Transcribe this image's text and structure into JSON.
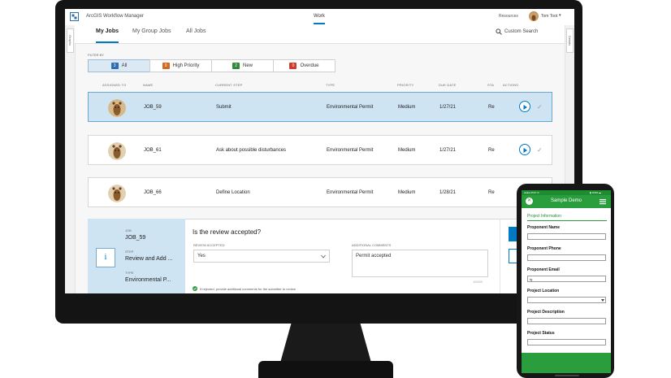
{
  "app": {
    "title": "ArcGIS Workflow Manager",
    "nav_work": "Work",
    "resources": "Resources",
    "user_name": "Tom Toot",
    "user_caret": "▾"
  },
  "rails": {
    "left": "Graphs",
    "right": "Details"
  },
  "tabs": [
    "My Jobs",
    "My Group Jobs",
    "All Jobs"
  ],
  "search": {
    "label": "Custom Search"
  },
  "filter": {
    "label": "FILTER BY",
    "chips": [
      {
        "count": "3",
        "label": "All",
        "color": "#2f6fb1"
      },
      {
        "count": "0",
        "label": "High Priority",
        "color": "#d2691e"
      },
      {
        "count": "2",
        "label": "New",
        "color": "#2e8b3a"
      },
      {
        "count": "0",
        "label": "Overdue",
        "color": "#d03a2a"
      }
    ]
  },
  "table": {
    "headers": [
      "ASSIGNED TO",
      "NAME",
      "CURRENT STEP",
      "TYPE",
      "PRIORITY",
      "DUE DATE",
      "STA",
      "ACTIONS"
    ],
    "rows": [
      {
        "name": "JOB_59",
        "step": "Submit",
        "type": "Environmental Permit",
        "priority": "Medium",
        "due": "1/27/21",
        "status": "Re"
      },
      {
        "name": "JOB_61",
        "step": "Ask about possible disturbances",
        "type": "Environmental Permit",
        "priority": "Medium",
        "due": "1/27/21",
        "status": "Re"
      },
      {
        "name": "JOB_66",
        "step": "Define Location",
        "type": "Environmental Permit",
        "priority": "Medium",
        "due": "1/28/21",
        "status": "Re"
      }
    ]
  },
  "detail": {
    "job_label": "JOB",
    "job_value": "JOB_59",
    "step_label": "STEP",
    "step_value": "Review and Add ...",
    "type_label": "TYPE",
    "type_value": "Environmental P...",
    "info_icon": "i",
    "question": "Is the review accepted?",
    "review_label": "REVIEW ACCEPTED",
    "review_value": "Yes",
    "comments_label": "ADDITIONAL COMMENTS",
    "comments_value": "Permit accepted",
    "char_count": "15/500",
    "hint": "If rejected, provide additional comments for the submitter to review"
  },
  "phone": {
    "status_left": "●●●● AT&T ≋",
    "status_right": "▮ 100% ▬",
    "title": "Sample Demo",
    "section": "Project Information",
    "fields": [
      {
        "label": "Proponent Name",
        "value": ""
      },
      {
        "label": "Proponent Phone",
        "value": ""
      },
      {
        "label": "Proponent Email",
        "value": "tg"
      },
      {
        "label": "Project Location",
        "value": ""
      },
      {
        "label": "Project Description",
        "value": ""
      },
      {
        "label": "Project Status",
        "value": ""
      }
    ]
  }
}
